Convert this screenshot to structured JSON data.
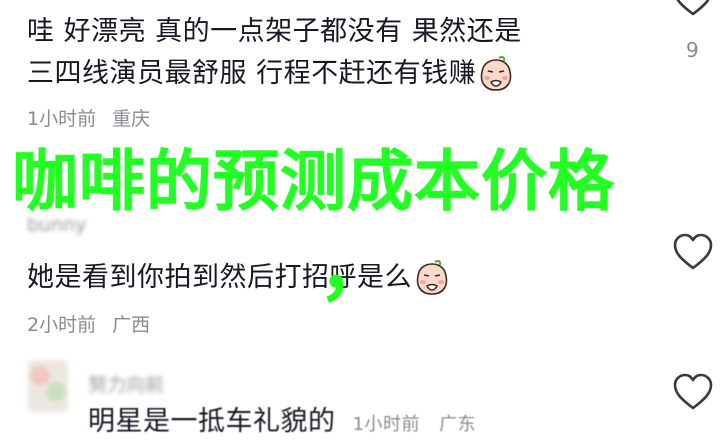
{
  "overlay": {
    "title": "咖啡的预测成本价格",
    "comma": "，"
  },
  "comments": [
    {
      "line1": "哇 好漂亮 真的一点架子都没有 果然还是",
      "line2": "三四线演员最舒服 行程不赶还有钱赚",
      "time": "1小时前",
      "location": "重庆",
      "likes": "9"
    },
    {
      "username": "bunny",
      "text": "她是看到你拍到然后打招呼是么",
      "time": "2小时前",
      "location": "广西"
    },
    {
      "username": "努力向前",
      "text": "明星是一抵车礼貌的",
      "time": "1小时前",
      "location": "广东"
    }
  ],
  "icons": {
    "heart": "heart-outline-icon",
    "emoji": "smirk-face-emoji"
  },
  "colors": {
    "overlay": "#22ff22",
    "meta": "#8a8b91",
    "text": "#161823"
  }
}
